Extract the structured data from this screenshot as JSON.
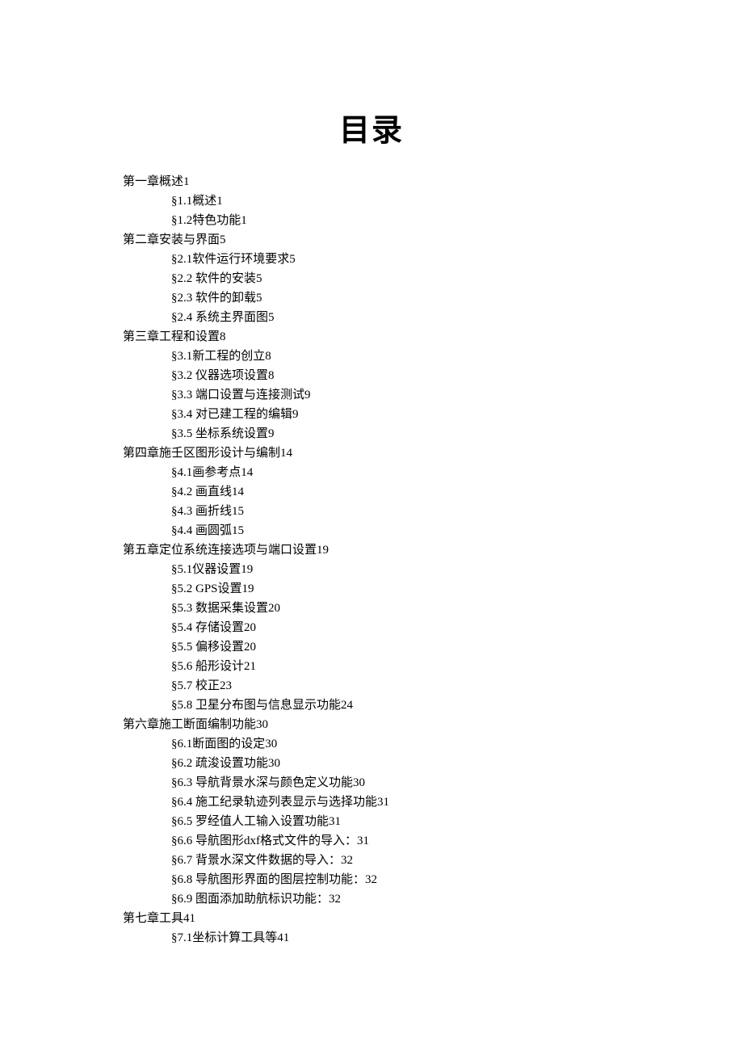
{
  "title": "目录",
  "toc": [
    {
      "chapter": "第一章概述1",
      "sections": [
        "§1.1概述1",
        "§1.2特色功能1"
      ]
    },
    {
      "chapter": "第二章安装与界面5",
      "sections": [
        "§2.1软件运行环境要求5",
        "§2.2 软件的安装5",
        "§2.3 软件的卸载5",
        "§2.4 系统主界面图5"
      ]
    },
    {
      "chapter": "第三章工程和设置8",
      "sections": [
        "§3.1新工程的创立8",
        "§3.2 仪器选项设置8",
        "§3.3 端口设置与连接测试9",
        "§3.4 对已建工程的编辑9",
        "§3.5 坐标系统设置9"
      ]
    },
    {
      "chapter": "第四章施壬区图形设计与编制14",
      "sections": [
        "§4.1画参考点14",
        "§4.2 画直线14",
        "§4.3 画折线15",
        "§4.4 画圆弧15"
      ]
    },
    {
      "chapter": "第五章定位系统连接选项与端口设置19",
      "sections": [
        "§5.1仪器设置19",
        "§5.2 GPS设置19",
        "§5.3 数据采集设置20",
        "§5.4 存储设置20",
        "§5.5 偏移设置20",
        "§5.6 船形设计21",
        "§5.7 校正23",
        "§5.8 卫星分布图与信息显示功能24"
      ]
    },
    {
      "chapter": "第六章施工断面编制功能30",
      "sections": [
        "§6.1断面图的设定30",
        "§6.2 疏浚设置功能30",
        "§6.3 导航背景水深与颜色定义功能30",
        "§6.4 施工纪录轨迹列表显示与选择功能31",
        "§6.5 罗经值人工输入设置功能31",
        "§6.6 导航图形dxf格式文件的导入：31",
        "§6.7 背景水深文件数据的导入：32",
        "§6.8 导航图形界面的图层控制功能：32",
        "§6.9 图面添加助航标识功能：32"
      ]
    },
    {
      "chapter": "第七章工具41",
      "sections": [
        "§7.1坐标计算工具等41"
      ]
    }
  ]
}
